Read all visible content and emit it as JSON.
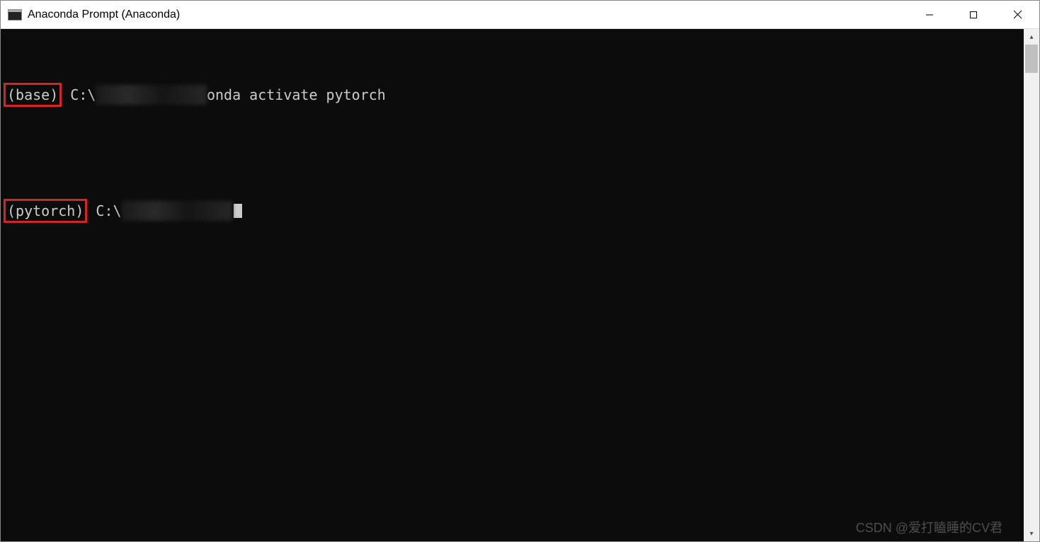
{
  "window": {
    "title": "Anaconda Prompt (Anaconda)"
  },
  "terminal": {
    "line1": {
      "env": "(base)",
      "prefix": " C:\\",
      "command_tail": "onda activate pytorch"
    },
    "line2": {
      "env": "(pytorch)",
      "prefix": " C:\\"
    }
  },
  "annotations": {
    "highlight_color": "#d22626"
  },
  "watermark": "CSDN @爱打瞌睡的CV君"
}
